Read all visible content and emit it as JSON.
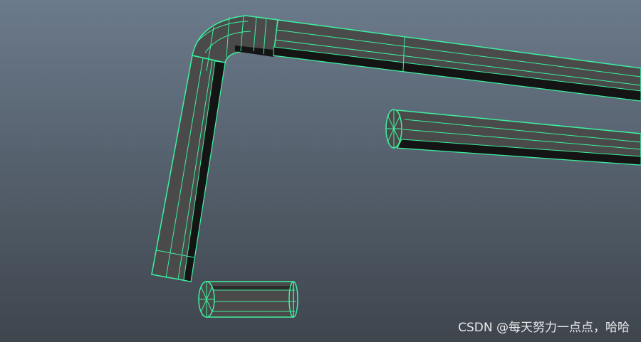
{
  "viewport": {
    "background_top": "#6b7a8b",
    "background_bottom": "#3e454d",
    "wireframe_color": "#3df0a0",
    "shaded_face_color": "#4a4a4a",
    "shadow_face_color": "#141414"
  },
  "objects": [
    {
      "name": "bent-hex-key",
      "type": "polygon-mesh",
      "selected": true
    },
    {
      "name": "long-cylinder",
      "type": "polygon-mesh",
      "selected": true
    },
    {
      "name": "short-cylinder",
      "type": "polygon-mesh",
      "selected": true
    }
  ],
  "watermark": {
    "text": "CSDN @每天努力一点点，哈哈"
  }
}
